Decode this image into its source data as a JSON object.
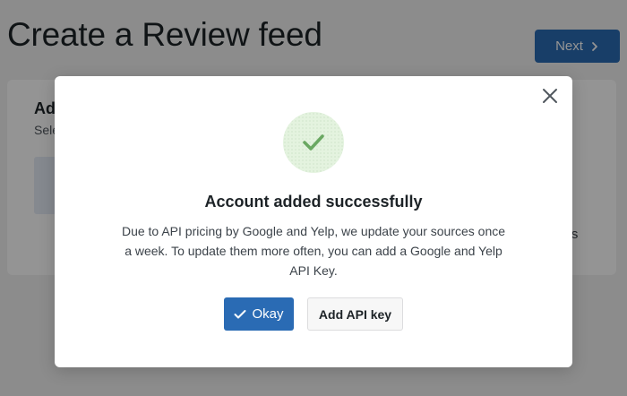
{
  "page": {
    "title": "Create a Review feed",
    "next_label": "Next",
    "card": {
      "heading": "Ad",
      "subtext": "Sele",
      "sources_text": "ces"
    }
  },
  "modal": {
    "icon": "check-icon",
    "title": "Account added successfully",
    "body": "Due to API pricing by Google and Yelp, we update your sources once a week. To update them more often, you can add a Google and Yelp API Key.",
    "okay_label": "Okay",
    "add_api_key_label": "Add API key",
    "close_icon": "close-icon"
  },
  "colors": {
    "primary": "#2a6bb4",
    "success_bg": "#e4f3df",
    "success_check": "#6aa862",
    "overlay": "rgba(0,0,0,0.42)"
  }
}
